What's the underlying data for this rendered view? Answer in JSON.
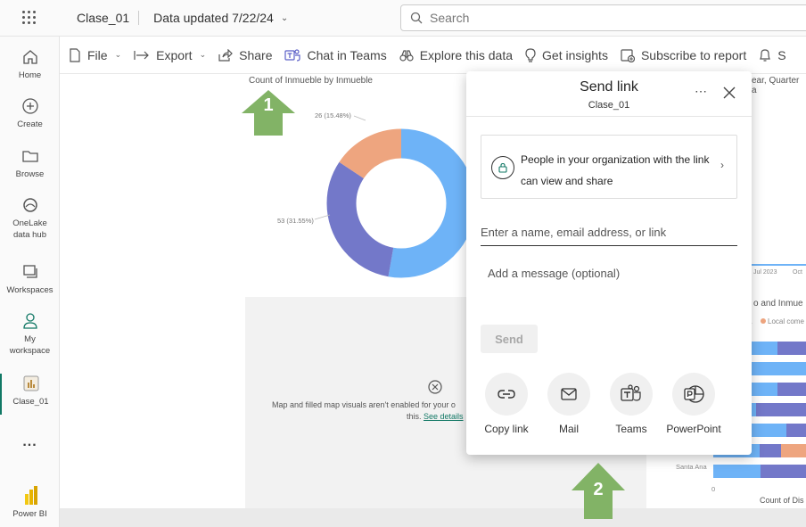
{
  "topbar": {
    "app_title": "Clase_01",
    "data_updated": "Data updated 7/22/24",
    "search_placeholder": "Search"
  },
  "leftnav": {
    "items": [
      {
        "label": "Home",
        "icon": "home-icon"
      },
      {
        "label": "Create",
        "icon": "plus-circle-icon"
      },
      {
        "label": "Browse",
        "icon": "folder-icon"
      },
      {
        "label": "OneLake data hub",
        "icon": "onelake-icon"
      },
      {
        "label": "Workspaces",
        "icon": "workspaces-icon"
      },
      {
        "label": "My workspace",
        "icon": "person-icon"
      },
      {
        "label": "Clase_01",
        "icon": "report-icon"
      },
      {
        "label": "...",
        "icon": "more-icon"
      },
      {
        "label": "Power BI",
        "icon": "powerbi-logo-icon"
      }
    ]
  },
  "toolbar": {
    "file": "File",
    "export": "Export",
    "share": "Share",
    "chat_in_teams": "Chat in Teams",
    "explore": "Explore this data",
    "insights": "Get insights",
    "subscribe": "Subscribe to report"
  },
  "report": {
    "donut_title": "Count of Inmueble by Inmueble",
    "donut_label_1": "26 (15.48%)",
    "donut_label_2": "53 (31.55%)",
    "top_right_title": "ear, Quarter a",
    "axis_label_jul": "Jul 2023",
    "axis_label_oct": "Oct",
    "bar_chart_title": "o and Inmue",
    "legend_item_1": "a",
    "legend_item_2": "Local come",
    "bar_row_label": "Santa Ana",
    "bar_axis_zero": "0",
    "bar_axis_title": "Count of Dis",
    "map_message": "Map and filled map visuals aren't enabled for your o",
    "map_message_2": "this.",
    "map_link": "See details"
  },
  "dialog": {
    "title": "Send link",
    "subtitle": "Clase_01",
    "permission_text": "People in your organization with the link can view and share",
    "name_placeholder": "Enter a name, email address, or link",
    "message_placeholder": "Add a message (optional)",
    "send_label": "Send",
    "options": [
      {
        "label": "Copy link",
        "icon": "link-icon"
      },
      {
        "label": "Mail",
        "icon": "mail-icon"
      },
      {
        "label": "Teams",
        "icon": "teams-icon"
      },
      {
        "label": "PowerPoint",
        "icon": "powerpoint-icon"
      }
    ]
  },
  "callouts": {
    "one": "1",
    "two": "2"
  },
  "colors": {
    "callout_green": "#82b366",
    "donut_blue": "#6eb3f7",
    "donut_purple": "#7378c9",
    "donut_orange": "#eea57f",
    "accent_teal": "#117865"
  }
}
